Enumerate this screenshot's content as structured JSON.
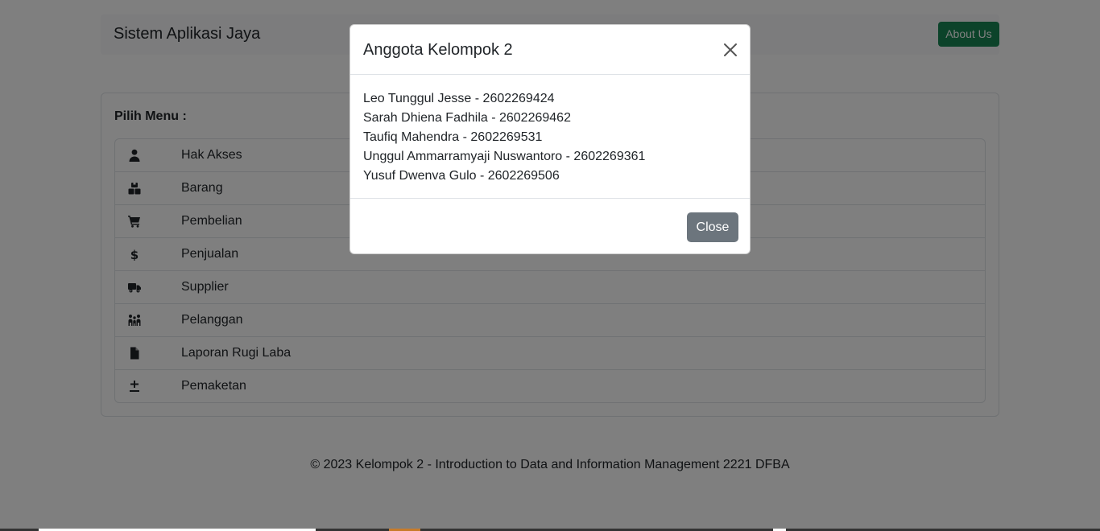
{
  "navbar": {
    "brand": "Sistem Aplikasi Jaya",
    "about_label": "About Us"
  },
  "menu": {
    "title": "Pilih Menu :",
    "items": [
      {
        "label": "Hak Akses",
        "icon": "user-icon"
      },
      {
        "label": "Barang",
        "icon": "boxes-icon"
      },
      {
        "label": "Pembelian",
        "icon": "cart-icon"
      },
      {
        "label": "Penjualan",
        "icon": "dollar-icon"
      },
      {
        "label": "Supplier",
        "icon": "truck-icon"
      },
      {
        "label": "Pelanggan",
        "icon": "people-icon"
      },
      {
        "label": "Laporan Rugi Laba",
        "icon": "file-icon"
      },
      {
        "label": "Pemaketan",
        "icon": "plus-minus-icon"
      }
    ]
  },
  "footer": {
    "text": "© 2023 Kelompok 2 - Introduction to Data and Information Management 2221 DFBA"
  },
  "modal": {
    "title": "Anggota Kelompok 2",
    "members": [
      "Leo Tunggul Jesse - 2602269424",
      "Sarah Dhiena Fadhila - 2602269462",
      "Taufiq Mahendra - 2602269531",
      "Unggul Ammarramyaji Nuswantoro - 2602269361",
      "Yusuf Dwenva Gulo - 2602269506"
    ],
    "close_label": "Close"
  },
  "colors": {
    "success": "#198754",
    "secondary": "#6c757d",
    "backdrop": "rgba(0,0,0,0.5)"
  }
}
